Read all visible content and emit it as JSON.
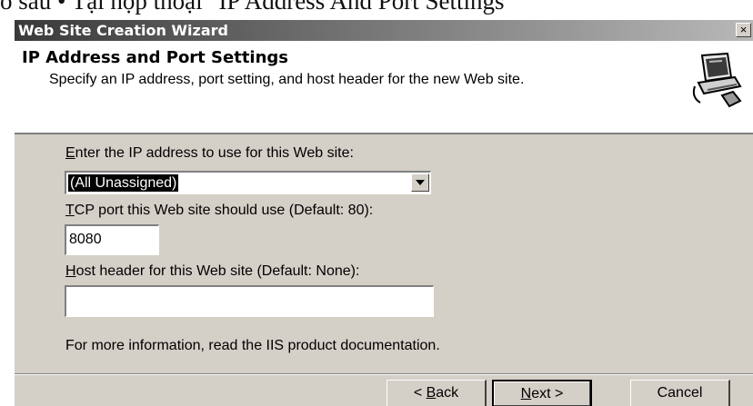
{
  "caption": "o sau • Tại hộp thoại \"IP Address And Port Settings\"",
  "window": {
    "title": "Web Site Creation Wizard",
    "close_glyph": "×"
  },
  "header": {
    "title": "IP Address and Port Settings",
    "subtitle": "Specify an IP address, port setting, and host header for the new Web site.",
    "icon": "wizard-computer-icon"
  },
  "form": {
    "ip_label_key": "E",
    "ip_label_rest": "nter the IP address to use for this Web site:",
    "ip_value": "(All Unassigned)",
    "port_label_key": "T",
    "port_label_rest": "CP port this Web site should use (Default: 80):",
    "port_value": "8080",
    "host_label_key": "H",
    "host_label_rest": "ost header for this Web site (Default: None):",
    "host_value": "",
    "info_text": "For more information, read the IIS product documentation."
  },
  "buttons": {
    "back_prefix": "< ",
    "back_key": "B",
    "back_rest": "ack",
    "next_key": "N",
    "next_rest": "ext >",
    "cancel": "Cancel"
  }
}
